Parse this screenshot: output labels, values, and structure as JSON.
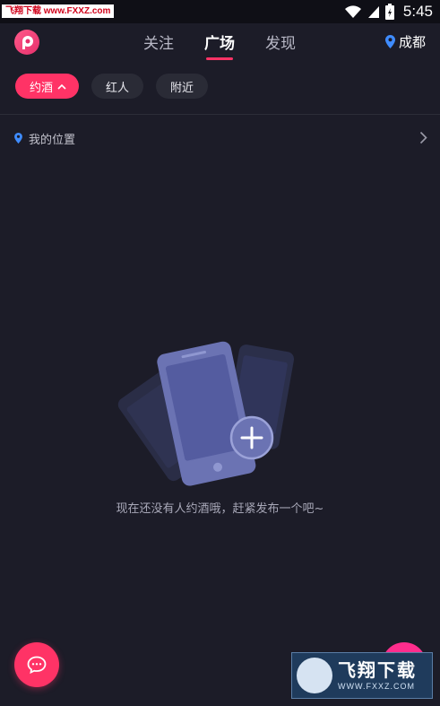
{
  "status_bar": {
    "watermark": "飞翔下载 www.FXXZ.com",
    "time": "5:45"
  },
  "header": {
    "tabs": [
      {
        "label": "关注",
        "active": false
      },
      {
        "label": "广场",
        "active": true
      },
      {
        "label": "发现",
        "active": false
      }
    ],
    "city": "成都"
  },
  "filters": {
    "chips": [
      {
        "label": "约酒",
        "active": true
      },
      {
        "label": "红人",
        "active": false
      },
      {
        "label": "附近",
        "active": false
      }
    ]
  },
  "location": {
    "label": "我的位置"
  },
  "empty_state": {
    "message": "现在还没有人约酒哦，赶紧发布一个吧~"
  },
  "watermark_badge": {
    "title": "飞翔下载",
    "url": "WWW.FXXZ.COM"
  },
  "colors": {
    "background": "#1c1c28",
    "accent": "#ff3366",
    "location_pin": "#3f8cff"
  },
  "icons": [
    "app-logo-icon",
    "location-pin-icon",
    "chevron-up-icon",
    "chevron-right-icon",
    "wifi-icon",
    "signal-icon",
    "battery-icon",
    "chat-icon",
    "plus-icon"
  ]
}
